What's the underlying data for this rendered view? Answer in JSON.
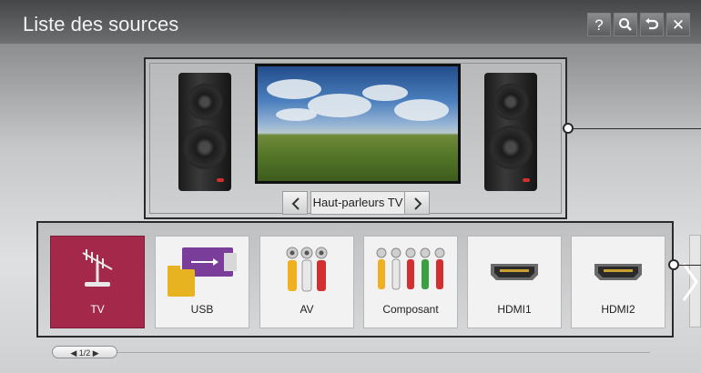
{
  "header": {
    "title": "Liste des sources",
    "buttons": [
      {
        "name": "help",
        "label": "?"
      },
      {
        "name": "search",
        "label": ""
      },
      {
        "name": "back",
        "label": ""
      },
      {
        "name": "close",
        "label": "✕"
      }
    ]
  },
  "speaker_panel": {
    "selected_output": "Haut-parleurs TV",
    "prev_icon": "chevron-left-icon",
    "next_icon": "chevron-right-icon"
  },
  "sources": {
    "items": [
      {
        "label": "TV",
        "icon": "antenna-icon",
        "selected": true
      },
      {
        "label": "USB",
        "icon": "usb-folder-icon",
        "selected": false
      },
      {
        "label": "AV",
        "icon": "av-rca-icon",
        "selected": false
      },
      {
        "label": "Composant",
        "icon": "component-rca-icon",
        "selected": false
      },
      {
        "label": "HDMI1",
        "icon": "hdmi-port-icon",
        "selected": false
      },
      {
        "label": "HDMI2",
        "icon": "hdmi-port-icon",
        "selected": false
      }
    ],
    "page_indicator": "◀ 1/2 ▶"
  },
  "colors": {
    "selected_tile": "#a3284a",
    "speaker_led": "#d0302e"
  }
}
